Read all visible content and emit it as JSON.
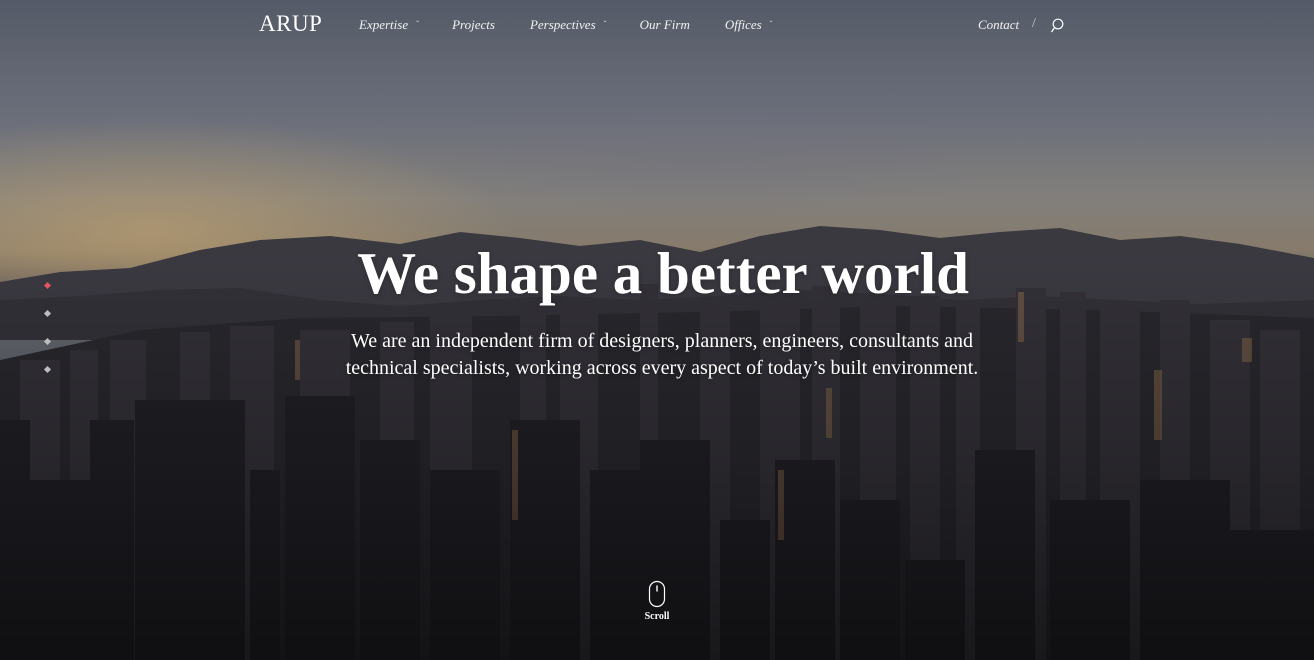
{
  "brand": {
    "logo_text": "ARUP"
  },
  "nav": {
    "items": [
      {
        "label": "Expertise",
        "has_dropdown": true
      },
      {
        "label": "Projects",
        "has_dropdown": false
      },
      {
        "label": "Perspectives",
        "has_dropdown": true
      },
      {
        "label": "Our Firm",
        "has_dropdown": false
      },
      {
        "label": "Offices",
        "has_dropdown": true
      }
    ],
    "contact_label": "Contact",
    "separator": "/",
    "dropdown_glyph": "ˇ",
    "search_icon": "search-icon"
  },
  "hero": {
    "headline": "We are an independent firm of designers, planners, engineers,",
    "title": "We shape a better world",
    "description": "We are an independent firm of designers, planners, engineers, consultants and technical specialists, working across every aspect of today’s built environment.",
    "slide_count": 4,
    "active_slide": 1,
    "scroll_label": "Scroll"
  },
  "colors": {
    "text": "#ffffff",
    "active_dot": "#e05561",
    "inactive_dot": "#bdbdbd"
  }
}
